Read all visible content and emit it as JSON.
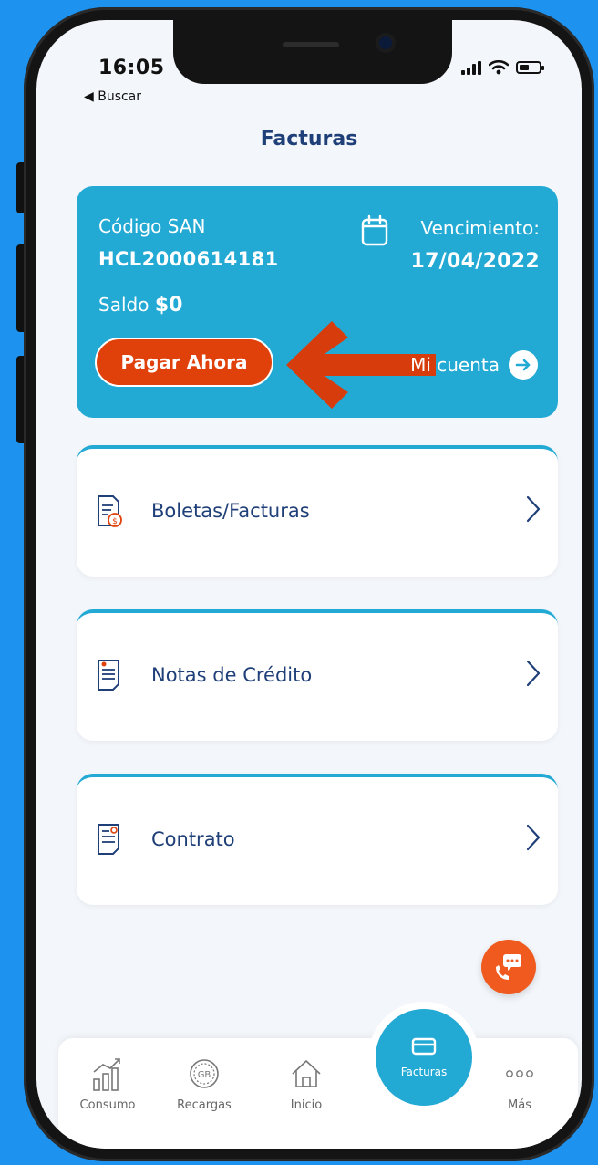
{
  "status": {
    "time": "16:05",
    "back_label": "◀ Buscar"
  },
  "header": {
    "title": "Facturas"
  },
  "account": {
    "code_label": "Código SAN",
    "code_value": "HCL2000614181",
    "balance_label": "Saldo",
    "balance_value": "$0",
    "due_label": "Vencimiento:",
    "due_date": "17/04/2022",
    "pay_button": "Pagar Ahora",
    "account_link": "Mi cuenta"
  },
  "menu": [
    {
      "label": "Boletas/Facturas",
      "icon": "invoice-dollar-icon"
    },
    {
      "label": "Notas de Crédito",
      "icon": "credit-note-icon"
    },
    {
      "label": "Contrato",
      "icon": "contract-icon"
    }
  ],
  "tabs": [
    {
      "label": "Consumo",
      "icon": "chart-icon"
    },
    {
      "label": "Recargas",
      "icon": "gb-icon"
    },
    {
      "label": "Inicio",
      "icon": "home-icon"
    },
    {
      "label": "Facturas",
      "icon": "card-icon",
      "active": true
    },
    {
      "label": "Más",
      "icon": "more-icon"
    }
  ],
  "colors": {
    "background": "#1d92ee",
    "brand": "#22a9d4",
    "primary_text": "#1f3f78",
    "pay_button": "#e0410a",
    "fab": "#f05a1e"
  }
}
